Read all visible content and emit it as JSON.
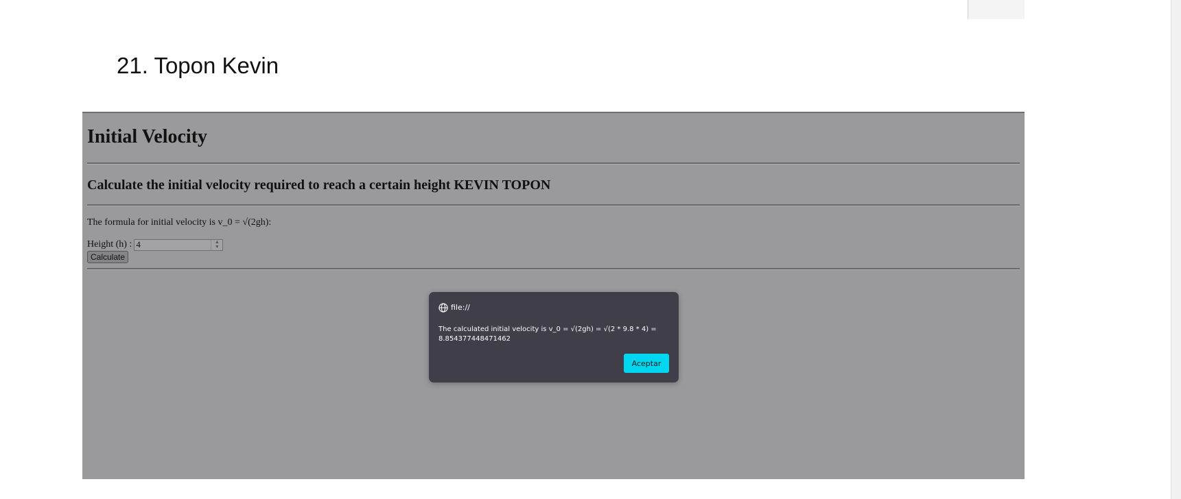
{
  "doc": {
    "title": "21. Topon Kevin"
  },
  "app": {
    "heading": "Initial Velocity",
    "subheading": "Calculate the initial velocity required to reach a certain height KEVIN TOPON",
    "formula_text": "The formula for initial velocity is v_0 = √(2gh):",
    "height_label": "Height (h) :",
    "height_value": "4",
    "calculate_label": "Calculate"
  },
  "dialog": {
    "origin": "file://",
    "message": "The calculated initial velocity is v_0 = √(2gh) = √(2 * 9.8 * 4) = 8.854377448471462",
    "ok_label": "Aceptar"
  },
  "colors": {
    "overlay": "#9a999b",
    "dialog_bg": "#403e49",
    "accent": "#00d6ef"
  },
  "icons": {
    "origin_icon": "globe-icon",
    "spinner_up": "chevron-up-icon",
    "spinner_down": "chevron-down-icon"
  }
}
